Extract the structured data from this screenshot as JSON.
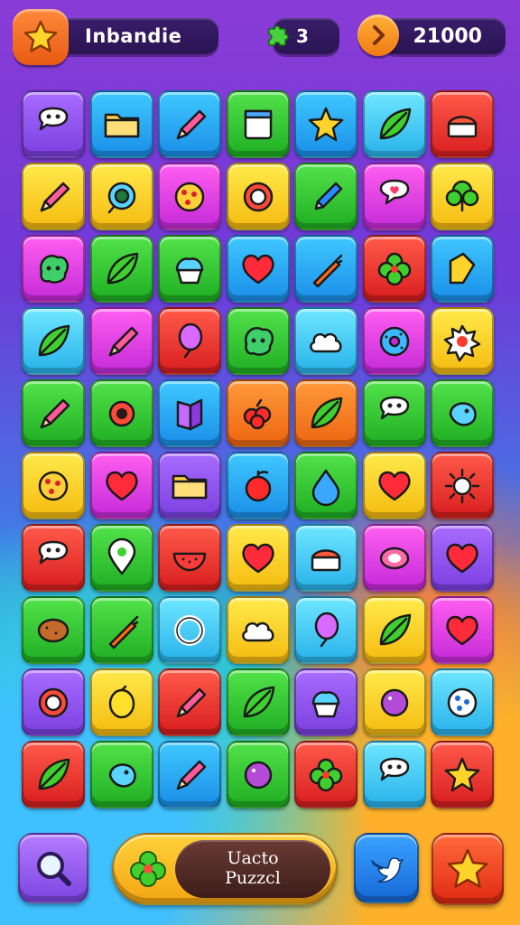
{
  "hud": {
    "player_name": "Inbandie",
    "moves": "3",
    "score": "21000",
    "icons": {
      "level_badge": "star-icon",
      "moves": "puzzle-piece-icon",
      "score_badge": "chevron-right-icon"
    }
  },
  "grid": {
    "columns": 7,
    "rows": 10,
    "tiles": [
      [
        "purple:chat",
        "blue:folder",
        "blue:pencil",
        "green:window",
        "blue:star",
        "cyan:leaf",
        "red:cake"
      ],
      [
        "yellow:pencil",
        "yellow:peacock",
        "magenta:cookie",
        "yellow:flower",
        "green:pen",
        "magenta:chat-heart",
        "yellow:tree"
      ],
      [
        "magenta:blob",
        "green:leaf",
        "green:cupcake",
        "blue:heart",
        "blue:carrot",
        "red:clover",
        "blue:note"
      ],
      [
        "cyan:leaf",
        "magenta:pencil",
        "red:balloon",
        "green:blob",
        "cyan:cloud",
        "magenta:donut",
        "yellow:splat"
      ],
      [
        "green:pencil",
        "green:gear",
        "blue:book",
        "orange:berries",
        "orange:leaf",
        "green:chat",
        "green:bird"
      ],
      [
        "yellow:cookie",
        "magenta:heart",
        "purple:folder",
        "blue:apple",
        "green:drop",
        "yellow:heart",
        "red:sun"
      ],
      [
        "red:chat",
        "green:pin",
        "red:watermelon",
        "yellow:heart",
        "cyan:cake",
        "magenta:gem",
        "purple:heart"
      ],
      [
        "green:potato",
        "green:carrot",
        "cyan:ring",
        "yellow:cloud",
        "cyan:balloon",
        "yellow:leaf",
        "magenta:heart"
      ],
      [
        "purple:flower",
        "yellow:lemon",
        "red:pencil",
        "green:leaf",
        "purple:cupcake",
        "yellow:berry",
        "cyan:dots"
      ],
      [
        "red:leaf",
        "green:bird",
        "blue:pencil",
        "green:berry",
        "red:clover",
        "cyan:chat",
        "red:star"
      ]
    ]
  },
  "bottom": {
    "search_icon": "magnifier-icon",
    "main_button": {
      "line1": "Uacto",
      "line2": "Puzzcl",
      "icon": "clover-icon"
    },
    "share_icon": "bird-icon",
    "bonus_icon": "star-icon"
  }
}
